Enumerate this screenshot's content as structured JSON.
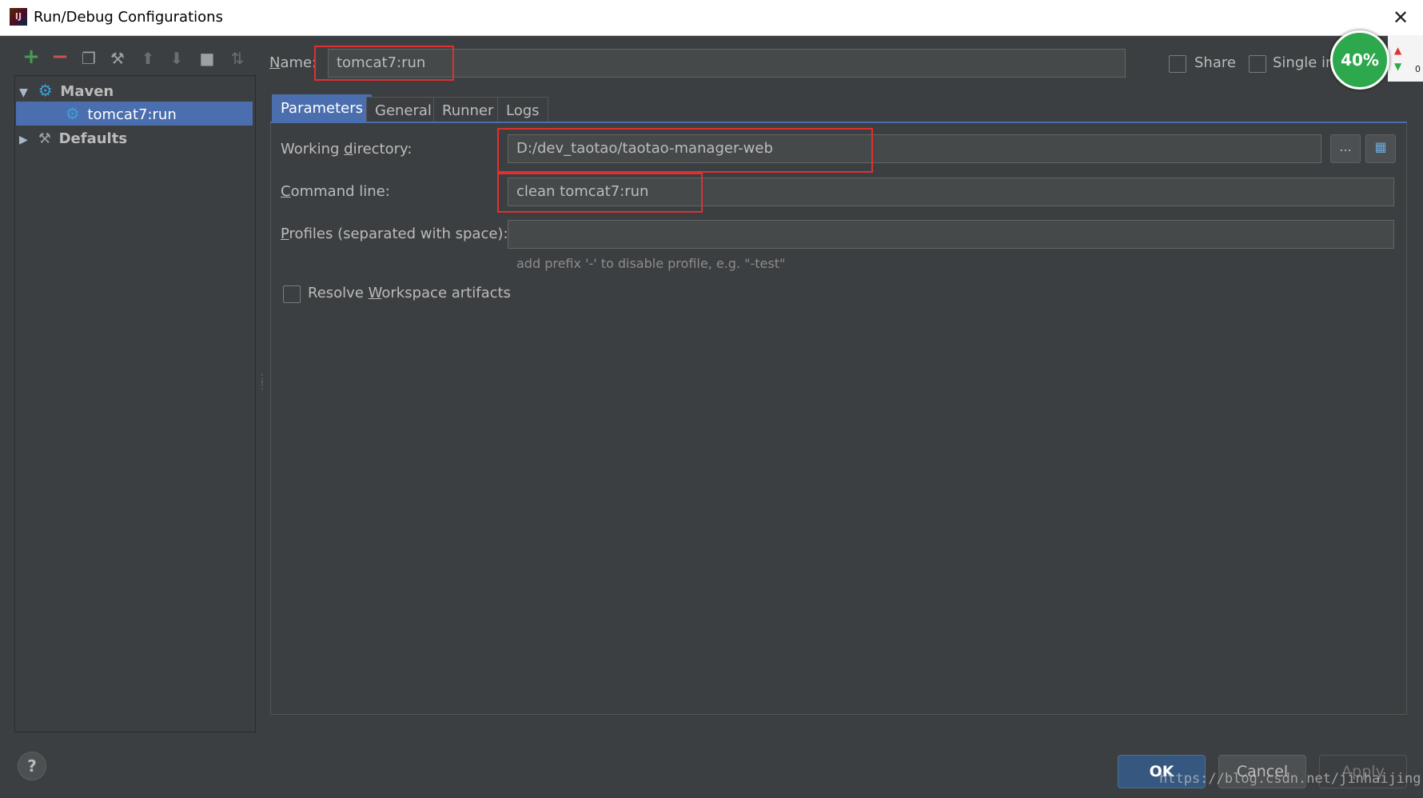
{
  "window": {
    "title": "Run/Debug Configurations",
    "close_label": "✕",
    "app_icon_label": "IJ"
  },
  "toolbar": {
    "icons": [
      "add-icon",
      "remove-icon",
      "copy-icon",
      "edit-defaults-icon",
      "move-up-icon",
      "move-down-icon",
      "folder-icon",
      "sort-icon"
    ]
  },
  "tree": {
    "items": [
      {
        "label": "Maven",
        "expanded": true
      },
      {
        "label": "tomcat7:run",
        "selected": true
      },
      {
        "label": "Defaults",
        "expanded": false
      }
    ]
  },
  "name_field": {
    "label": "Name:",
    "value": "tomcat7:run"
  },
  "share": {
    "label": "Share"
  },
  "single_instance": {
    "label": "Single in"
  },
  "tabs": [
    "Parameters",
    "General",
    "Runner",
    "Logs"
  ],
  "parameters": {
    "working_directory": {
      "label": "Working directory:",
      "value": "D:/dev_taotao/taotao-manager-web",
      "browse_label": "...",
      "module_label": "▦"
    },
    "command_line": {
      "label": "Command line:",
      "value": "clean tomcat7:run"
    },
    "profiles": {
      "label": "Profiles (separated with space):",
      "value": "",
      "hint": "add prefix '-' to disable profile, e.g. \"-test\""
    },
    "resolve_workspace": {
      "label": "Resolve Workspace artifacts",
      "checked": false
    }
  },
  "buttons": {
    "ok": "OK",
    "cancel": "Cancel",
    "apply": "Apply",
    "help": "?"
  },
  "overlay": {
    "percent": "40%",
    "zero": "0"
  },
  "watermark": "https://blog.csdn.net/jinhaijing",
  "colors": {
    "accent": "#4b6eaf",
    "highlight": "#e03030",
    "badge": "#2ea84c",
    "background": "#3c3f41"
  }
}
